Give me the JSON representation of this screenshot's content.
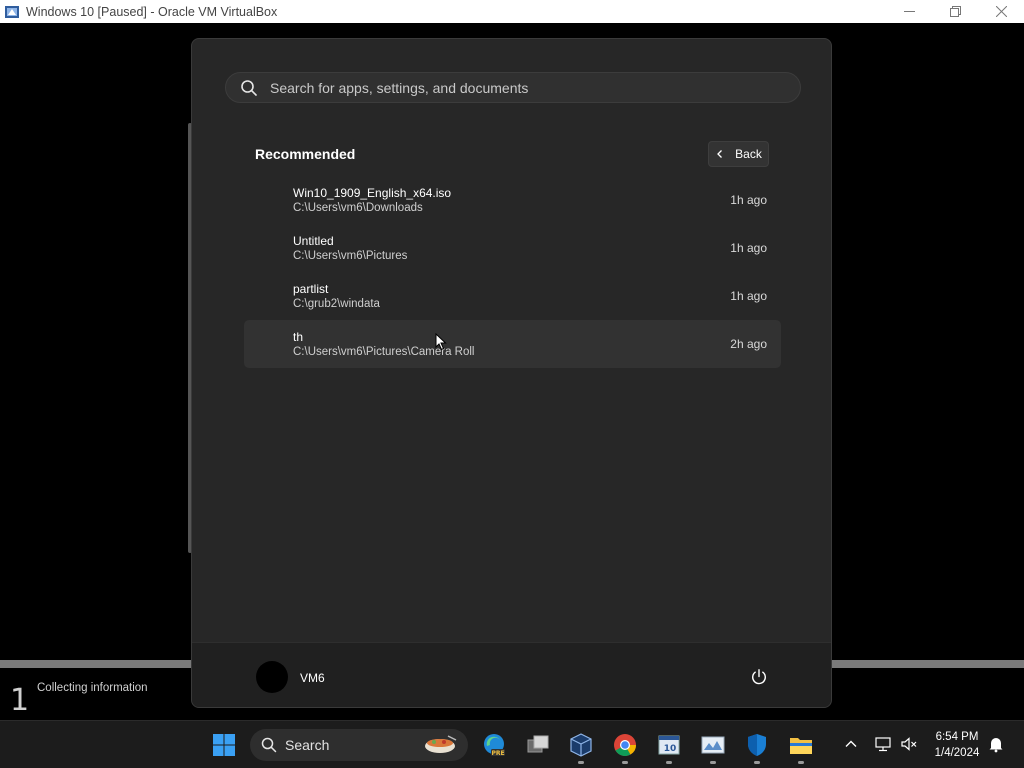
{
  "host_window": {
    "title": "Windows 10 [Paused] - Oracle VM VirtualBox",
    "minimize_icon": "minimize-icon",
    "restore_icon": "restore-icon",
    "close_icon": "close-icon"
  },
  "setup_progress": {
    "step_number": "1",
    "step_label": "Collecting information"
  },
  "start_menu": {
    "search_placeholder": "Search for apps, settings, and documents",
    "recommended_title": "Recommended",
    "back_label": "Back",
    "items": [
      {
        "name": "Win10_1909_English_x64.iso",
        "path": "C:\\Users\\vm6\\Downloads",
        "time": "1h ago"
      },
      {
        "name": "Untitled",
        "path": "C:\\Users\\vm6\\Pictures",
        "time": "1h ago"
      },
      {
        "name": "partlist",
        "path": "C:\\grub2\\windata",
        "time": "1h ago"
      },
      {
        "name": "th",
        "path": "C:\\Users\\vm6\\Pictures\\Camera Roll",
        "time": "2h ago"
      }
    ],
    "user_name": "VM6"
  },
  "taskbar": {
    "search_label": "Search",
    "clock_time": "6:54 PM",
    "clock_date": "1/4/2024",
    "apps": [
      "windows-start-icon",
      "edge-preview-icon",
      "task-view-icon",
      "virtualbox-icon",
      "chrome-icon",
      "sticky-app-icon",
      "photo-viewer-icon",
      "defender-shield-icon",
      "file-explorer-icon"
    ]
  },
  "colors": {
    "menu_bg": "#272727",
    "footer_bg": "#202020",
    "taskbar_bg": "#1c1c1c",
    "accent_blue": "#0078d4"
  }
}
